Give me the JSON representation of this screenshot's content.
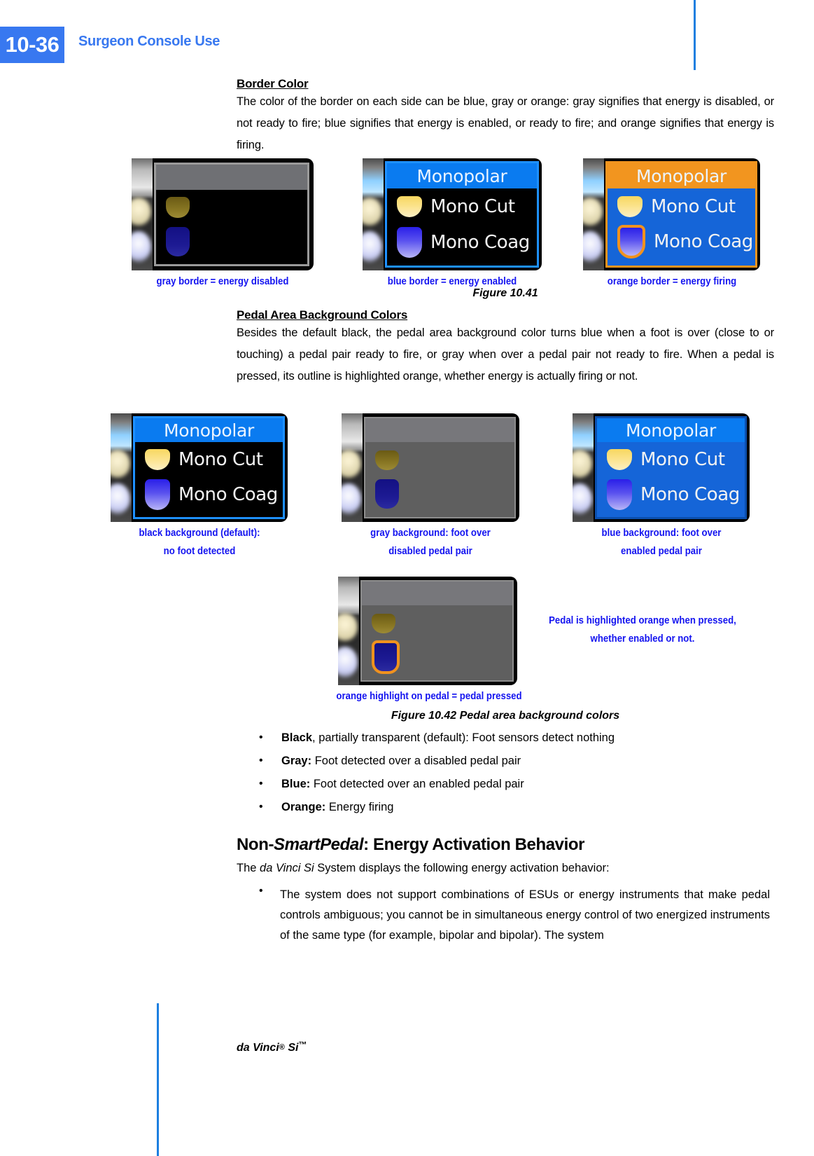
{
  "page": {
    "number": "10-36",
    "chapter_title": "Surgeon Console Use",
    "footer": "da Vinci",
    "footer_reg": "®",
    "footer_model": " Si",
    "footer_tm": "™"
  },
  "colors": {
    "accent_blue": "#3878f0",
    "caption_blue": "#1414f0",
    "orange": "#f0921e",
    "pedal_yellow": "#f7d760",
    "pedal_blue": "#2a1fe8",
    "panel_gray": "#6b6b6b",
    "panel_black": "#000000"
  },
  "sections": {
    "border_color": {
      "heading": "Border Color",
      "body": "The color of the border on each side can be blue, gray or orange: gray signifies that energy is disabled, or not ready to fire; blue signifies that energy is enabled, or ready to fire; and orange signifies that energy is firing."
    },
    "pedal_area": {
      "heading": "Pedal Area Background Colors",
      "body": "Besides the default black, the pedal area background color turns blue when a foot is over (close to or touching) a pedal pair ready to fire, or gray when over a pedal pair not ready to fire. When a pedal is pressed, its outline is highlighted orange, whether energy is actually firing or not."
    },
    "non_smartpedal": {
      "heading_prefix": "Non-",
      "heading_italic": "SmartPedal",
      "heading_suffix": ": Energy Activation Behavior",
      "intro_prefix": "The ",
      "intro_italic": "da Vinci Si",
      "intro_suffix": " System displays the following energy activation behavior:",
      "bullets": [
        "The system does not support combinations of ESUs or energy instruments that make pedal controls ambiguous; you cannot be in simultaneous energy control of two energized instruments of the same type (for example, bipolar and bipolar). The system"
      ]
    }
  },
  "figure_10_41": {
    "label": "Figure 10.41",
    "panels": [
      {
        "caption": "gray border = energy disabled",
        "border_color": "gray",
        "title": "",
        "title_bar_color": "#6f7074",
        "screen_bg": "#000000",
        "rows": [
          {
            "label": "",
            "pedal": "cut",
            "state": "dim"
          },
          {
            "label": "",
            "pedal": "coag",
            "state": "dim"
          }
        ]
      },
      {
        "caption": "blue border = energy enabled",
        "border_color": "blue",
        "title": "Monopolar",
        "title_bar_color": "#0a7bf0",
        "screen_bg": "#000000",
        "rows": [
          {
            "label": "Mono Cut",
            "pedal": "cut",
            "state": "bright"
          },
          {
            "label": "Mono Coag",
            "pedal": "coag",
            "state": "bright"
          }
        ]
      },
      {
        "caption": "orange border = energy firing",
        "border_color": "orange",
        "title": "Monopolar",
        "title_bar_color": "#f2951f",
        "screen_bg": "#1565d8",
        "rows": [
          {
            "label": "Mono Cut",
            "pedal": "cut",
            "state": "bright"
          },
          {
            "label": "Mono Coag",
            "pedal": "coag",
            "state": "pressed"
          }
        ]
      }
    ]
  },
  "figure_10_42": {
    "label": "Figure 10.42 Pedal area background colors",
    "panels": [
      {
        "caption_line1": "black background (default):",
        "caption_line2": "no foot detected",
        "border_color": "blue",
        "title": "Monopolar",
        "title_bar_color": "#0a7bf0",
        "screen_bg": "#000000",
        "rows": [
          {
            "label": "Mono Cut",
            "pedal": "cut",
            "state": "bright"
          },
          {
            "label": "Mono Coag",
            "pedal": "coag",
            "state": "bright"
          }
        ]
      },
      {
        "caption_line1": "gray background: foot over",
        "caption_line2": "disabled pedal pair",
        "border_color": "gray",
        "title": "",
        "title_bar_color": "#77777b",
        "screen_bg": "#5f5f5f",
        "rows": [
          {
            "label": "",
            "pedal": "cut",
            "state": "dim"
          },
          {
            "label": "",
            "pedal": "coag",
            "state": "dim"
          }
        ]
      },
      {
        "caption_line1": "blue background: foot over",
        "caption_line2": "enabled pedal pair",
        "border_color": "blue",
        "title": "Monopolar",
        "title_bar_color": "#0a7bf0",
        "screen_bg": "#1565d8",
        "rows": [
          {
            "label": "Mono Cut",
            "pedal": "cut",
            "state": "bright"
          },
          {
            "label": "Mono Coag",
            "pedal": "coag",
            "state": "bright"
          }
        ]
      }
    ],
    "pressed_panel": {
      "caption": "orange highlight on pedal = pedal pressed",
      "side_note_line1": "Pedal is highlighted orange when pressed,",
      "side_note_line2": "whether enabled or not.",
      "border_color": "gray",
      "title": "",
      "title_bar_color": "#77777b",
      "screen_bg": "#5f5f5f",
      "rows": [
        {
          "label": "",
          "pedal": "cut",
          "state": "dim"
        },
        {
          "label": "",
          "pedal": "coag",
          "state": "dim-pressed"
        }
      ]
    },
    "legend": [
      {
        "term": "Black",
        "term_tail": ", partially transparent (default):",
        "desc": " Foot sensors detect nothing"
      },
      {
        "term": "Gray:",
        "term_tail": "",
        "desc": " Foot detected over a disabled pedal pair"
      },
      {
        "term": "Blue:",
        "term_tail": "",
        "desc": " Foot detected over an enabled pedal pair"
      },
      {
        "term": "Orange:",
        "term_tail": "",
        "desc": " Energy firing"
      }
    ]
  }
}
